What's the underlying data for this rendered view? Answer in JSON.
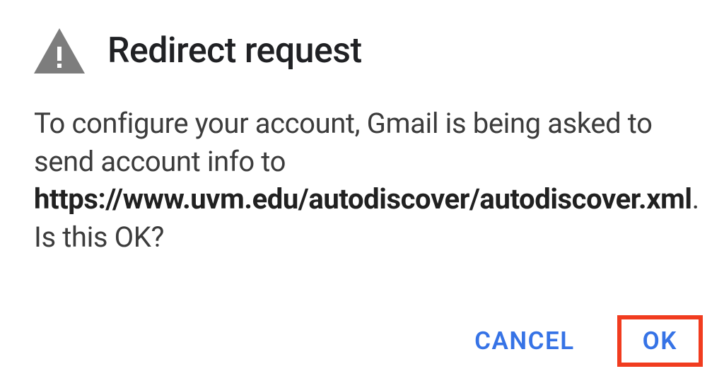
{
  "dialog": {
    "title": "Redirect request",
    "body_pre": "To configure your account, Gmail is being asked to send account info to ",
    "body_bold": "https://www.uvm.edu/autodiscover/autodiscover.xml",
    "body_post": ". Is this OK?",
    "cancel_label": "CANCEL",
    "ok_label": "OK"
  },
  "icons": {
    "warning": "warning-triangle"
  },
  "colors": {
    "accent": "#3673e6",
    "highlight_box": "#f13c1f",
    "icon_fill": "#7d7d7d"
  }
}
